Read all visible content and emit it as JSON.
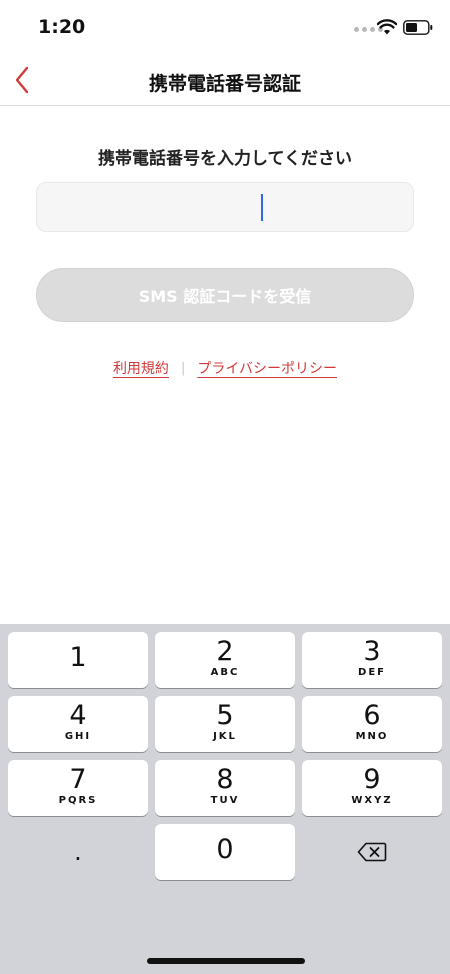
{
  "status_bar": {
    "time": "1:20"
  },
  "nav": {
    "title": "携帯電話番号認証"
  },
  "form": {
    "prompt": "携帯電話番号を入力してください",
    "phone_value": "",
    "sms_button_label": "SMS 認証コードを受信"
  },
  "links": {
    "terms": "利用規約",
    "separator": "|",
    "privacy": "プライバシーポリシー"
  },
  "keypad": {
    "keys": [
      {
        "digit": "1",
        "letters": ""
      },
      {
        "digit": "2",
        "letters": "ABC"
      },
      {
        "digit": "3",
        "letters": "DEF"
      },
      {
        "digit": "4",
        "letters": "GHI"
      },
      {
        "digit": "5",
        "letters": "JKL"
      },
      {
        "digit": "6",
        "letters": "MNO"
      },
      {
        "digit": "7",
        "letters": "PQRS"
      },
      {
        "digit": "8",
        "letters": "TUV"
      },
      {
        "digit": "9",
        "letters": "WXYZ"
      },
      {
        "digit": "0",
        "letters": ""
      }
    ],
    "dot_label": ".",
    "delete_icon": "backspace-icon"
  },
  "colors": {
    "accent_red": "#d23a3a",
    "caret_blue": "#2c68e0",
    "disabled_button": "#dcdcdc",
    "keypad_background": "#d1d3d9"
  }
}
